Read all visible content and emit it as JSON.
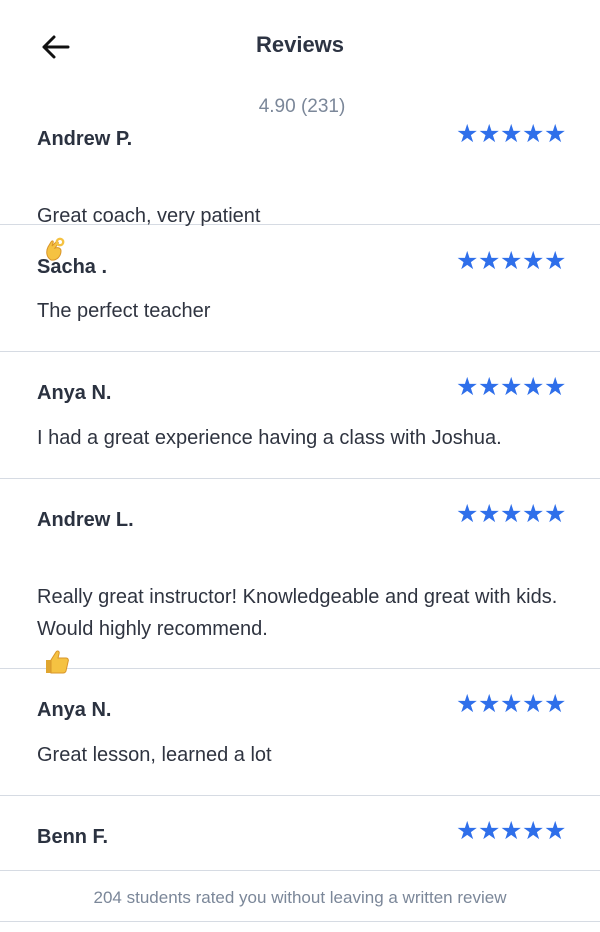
{
  "header": {
    "title": "Reviews",
    "back_icon": "arrow-left-icon"
  },
  "summary": {
    "rating_text": "4.90 (231)"
  },
  "reviews": [
    {
      "name": "Andrew P.",
      "stars": 5,
      "text": "Great coach, very patient",
      "emoji": "ok-hand-icon"
    },
    {
      "name": "Sacha .",
      "stars": 5,
      "text": "The perfect teacher"
    },
    {
      "name": "Anya N.",
      "stars": 5,
      "text": "I had a great experience having a class with Joshua."
    },
    {
      "name": "Andrew L.",
      "stars": 5,
      "text": "Really great instructor!  Knowledgeable and great with kids.\nWould highly recommend.",
      "emoji": "thumbs-up-icon"
    },
    {
      "name": "Anya N.",
      "stars": 5,
      "text": "Great lesson, learned a lot"
    },
    {
      "name": "Benn F.",
      "stars": 5,
      "text": ""
    }
  ],
  "footer": {
    "text": "204 students rated you without leaving a written review"
  },
  "colors": {
    "star": "#2f6fea",
    "muted_text": "#7b8799",
    "divider": "#d6dbe3"
  }
}
